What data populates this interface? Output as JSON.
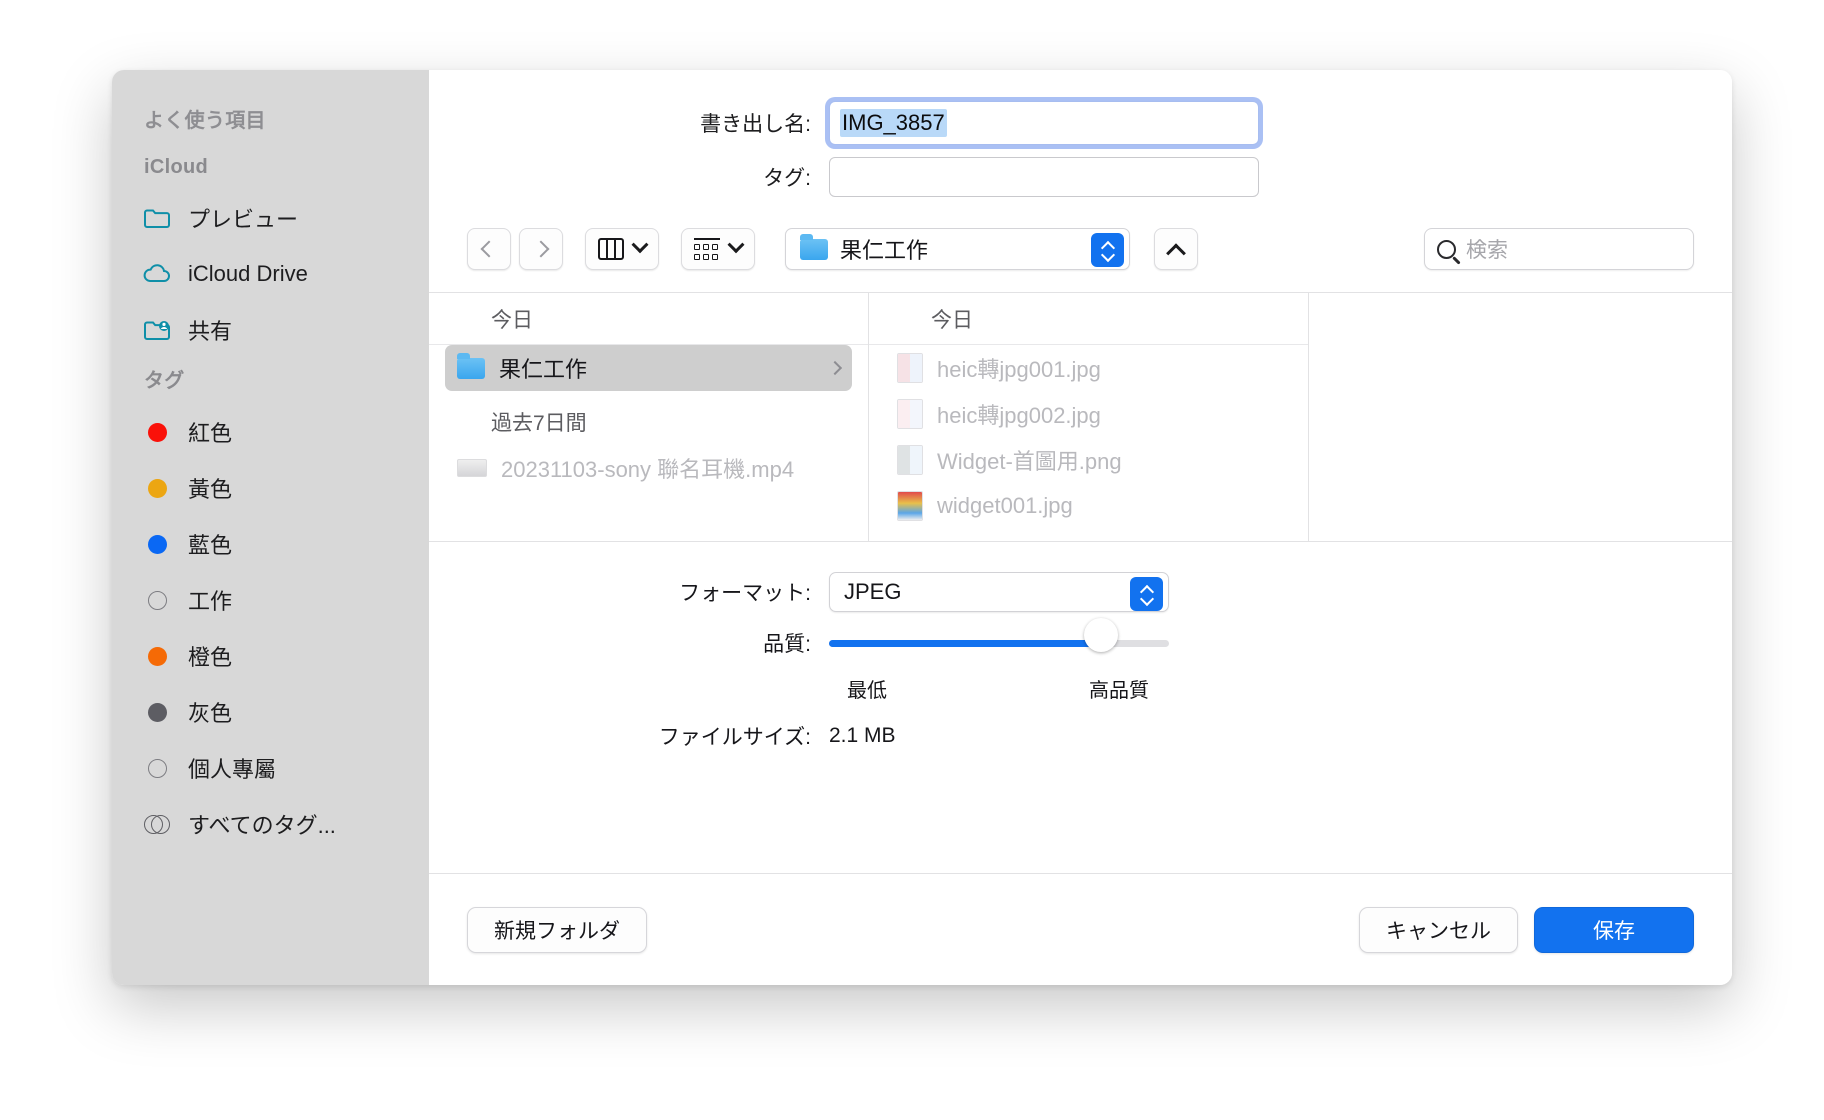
{
  "sidebar": {
    "sections": [
      {
        "title": "よく使う項目",
        "items": []
      },
      {
        "title": "iCloud",
        "items": [
          {
            "label": "プレビュー",
            "icon": "folder-outline-icon"
          },
          {
            "label": "iCloud Drive",
            "icon": "cloud-icon"
          },
          {
            "label": "共有",
            "icon": "shared-folder-icon"
          }
        ]
      },
      {
        "title": "タグ",
        "items": [
          {
            "label": "紅色",
            "icon": "tag-dot-icon",
            "color": "#fa1109"
          },
          {
            "label": "黃色",
            "icon": "tag-dot-icon",
            "color": "#eca612"
          },
          {
            "label": "藍色",
            "icon": "tag-dot-icon",
            "color": "#0a68f4"
          },
          {
            "label": "工作",
            "icon": "tag-dot-hollow-icon",
            "color": "none"
          },
          {
            "label": "橙色",
            "icon": "tag-dot-icon",
            "color": "#f56a06"
          },
          {
            "label": "灰色",
            "icon": "tag-dot-icon",
            "color": "#5d5d63"
          },
          {
            "label": "個人專屬",
            "icon": "tag-dot-hollow-icon",
            "color": "none"
          },
          {
            "label": "すべてのタグ...",
            "icon": "all-tags-icon",
            "color": "none"
          }
        ]
      }
    ]
  },
  "form": {
    "filename_label": "書き出し名:",
    "filename_value": "IMG_3857",
    "tags_label": "タグ:",
    "tags_value": ""
  },
  "toolbar": {
    "back_icon": "chevron-left-icon",
    "forward_icon": "chevron-right-icon",
    "view_icon": "column-view-icon",
    "view_chevron": "chevron-down-icon",
    "group_icon": "grid-view-icon",
    "group_chevron": "chevron-down-icon",
    "path_folder_icon": "folder-icon",
    "path_name": "果仁工作",
    "path_stepper_icon": "up-down-stepper-icon",
    "up_button_icon": "chevron-up-icon",
    "search_icon": "search-icon",
    "search_placeholder": "検索"
  },
  "browser": {
    "column1": {
      "header": "今日",
      "groups": [
        {
          "label": "",
          "items": [
            {
              "name": "果仁工作",
              "icon": "folder-icon",
              "selected": true,
              "has_arrow": true
            }
          ]
        },
        {
          "label": "過去7日間",
          "items": [
            {
              "name": "20231103-sony 聯名耳機.mp4",
              "icon": "movie-thumb-icon",
              "selected": false,
              "has_arrow": false
            }
          ]
        }
      ]
    },
    "column2": {
      "header": "今日",
      "items": [
        {
          "name": "heic轉jpg001.jpg",
          "icon": "image-thumb-icon"
        },
        {
          "name": "heic轉jpg002.jpg",
          "icon": "image-thumb-icon"
        },
        {
          "name": "Widget-首圖用.png",
          "icon": "image-thumb-icon"
        },
        {
          "name": "widget001.jpg",
          "icon": "image-thumb-icon"
        }
      ]
    }
  },
  "options": {
    "format_label": "フォーマット:",
    "format_value": "JPEG",
    "format_stepper_icon": "up-down-stepper-icon",
    "quality_label": "品質:",
    "quality_percent": 80,
    "quality_min_label": "最低",
    "quality_max_label": "高品質",
    "filesize_label": "ファイルサイズ:",
    "filesize_value": "2.1 MB"
  },
  "footer": {
    "new_folder_label": "新規フォルダ",
    "cancel_label": "キャンセル",
    "save_label": "保存"
  },
  "colors": {
    "accent": "#1272ef",
    "sidebar_bg": "#d8d8d8",
    "selection_highlight": "#b9d9f8"
  }
}
